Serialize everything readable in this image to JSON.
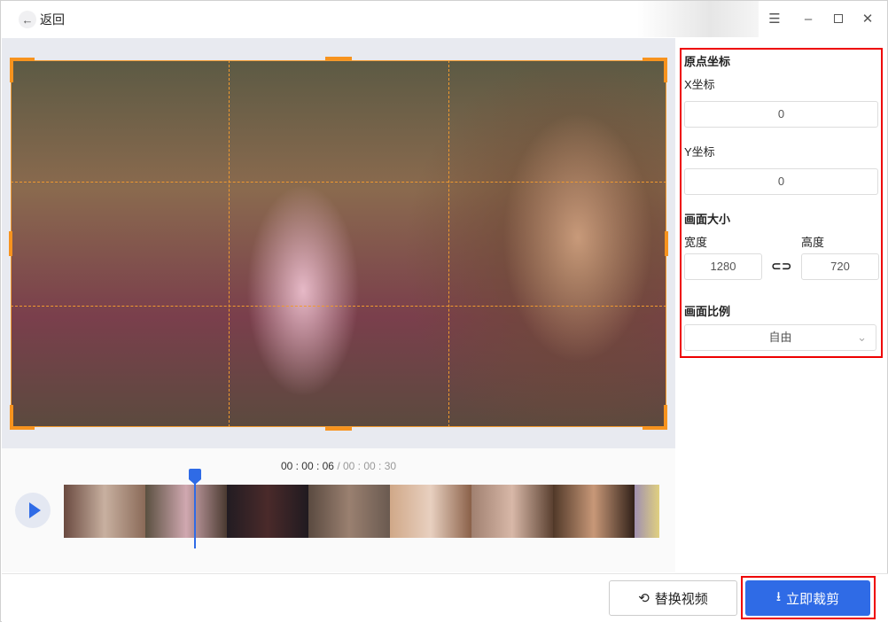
{
  "header": {
    "back_label": "返回",
    "menu_icon": "menu-icon",
    "minimize_icon": "minimize-icon",
    "maximize_icon": "maximize-icon",
    "close_icon": "close-icon"
  },
  "timeline": {
    "current": "00 : 00 : 06",
    "separator": " / ",
    "total": "00 : 00 : 30",
    "progress_fraction": 0.2
  },
  "panel": {
    "origin_title": "原点坐标",
    "x_label": "X坐标",
    "x_value": "0",
    "y_label": "Y坐标",
    "y_value": "0",
    "size_title": "画面大小",
    "width_label": "宽度",
    "width_value": "1280",
    "height_label": "高度",
    "height_value": "720",
    "link_icon": "link-icon",
    "ratio_title": "画面比例",
    "ratio_value": "自由"
  },
  "footer": {
    "replace_label": "替换视频",
    "crop_label": "立即裁剪"
  },
  "colors": {
    "accent": "#2f6be6",
    "crop_frame": "#f7931e",
    "highlight": "#ee0000"
  }
}
